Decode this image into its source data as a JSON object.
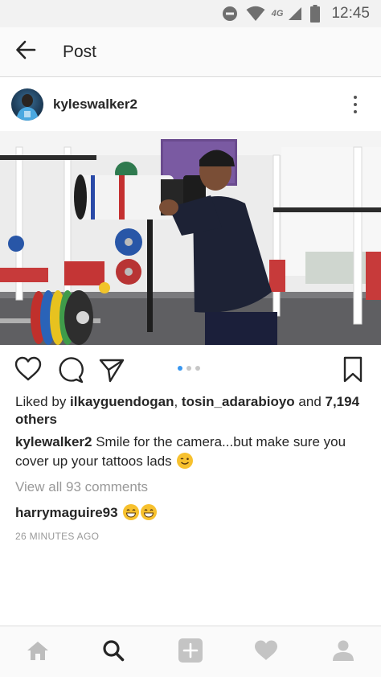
{
  "status_bar": {
    "time": "12:45",
    "network": "4G",
    "icons": [
      "do-not-disturb-icon",
      "wifi-icon",
      "signal-icon",
      "battery-icon"
    ]
  },
  "app_bar": {
    "title": "Post",
    "back_icon": "arrow-left-icon"
  },
  "post": {
    "username": "kyleswalker2",
    "more_icon": "vertical-dots-icon",
    "carousel": {
      "count": 3,
      "active_index": 0
    },
    "likes": {
      "prefix": "Liked by ",
      "user1": "ilkayguendogan",
      "separator": ", ",
      "user2": "tosin_adarabioyo",
      "and": " and ",
      "others": "7,194 others"
    },
    "caption": {
      "username": "kylewalker2",
      "text": " Smile for the camera...but make sure you cover up your tattoos lads "
    },
    "view_all_comments": "View all 93 comments",
    "comment": {
      "username": "harrymaguire93"
    },
    "timestamp": "26 MINUTES AGO"
  },
  "action_icons": [
    "heart-icon",
    "comment-icon",
    "share-icon",
    "bookmark-icon"
  ],
  "bottom_nav": [
    "home-icon",
    "search-icon",
    "add-post-icon",
    "activity-heart-icon",
    "profile-icon"
  ],
  "colors": {
    "accent_blue": "#3897f0",
    "text": "#262626",
    "muted": "#999999",
    "emoji_yellow": "#f7c12e"
  }
}
